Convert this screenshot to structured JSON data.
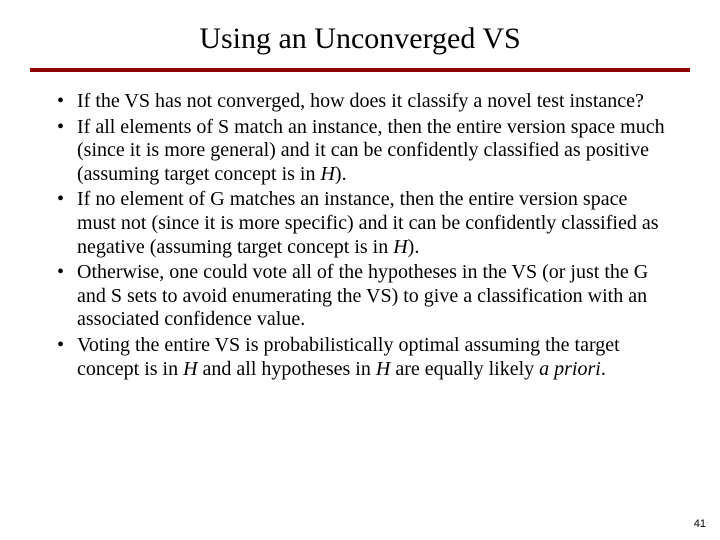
{
  "title": "Using an Unconverged VS",
  "bullets": [
    {
      "pre": "If the VS has not converged, how does it classify a novel test instance?",
      "it": "",
      "post": ""
    },
    {
      "pre": "If all elements of S match an instance, then the entire version space much (since it is more general) and it can be confidently classified as positive (assuming target concept is in ",
      "it": "H",
      "post": ")."
    },
    {
      "pre": "If no element of G matches an instance, then the entire version space must not (since it is more specific) and it can be confidently classified as negative (assuming target concept is in ",
      "it": "H",
      "post": ")."
    },
    {
      "pre": "Otherwise, one could vote all of the hypotheses in the VS (or just the G and S sets to avoid enumerating the VS) to give a classification with an associated confidence value.",
      "it": "",
      "post": ""
    },
    {
      "pre": "Voting the entire VS is probabilistically optimal assuming the target concept is in ",
      "it": "H",
      "post": " and all hypotheses in ",
      "it2": "H",
      "post2": " are equally likely ",
      "it3": "a priori",
      "post3": "."
    }
  ],
  "pagenum": "41"
}
